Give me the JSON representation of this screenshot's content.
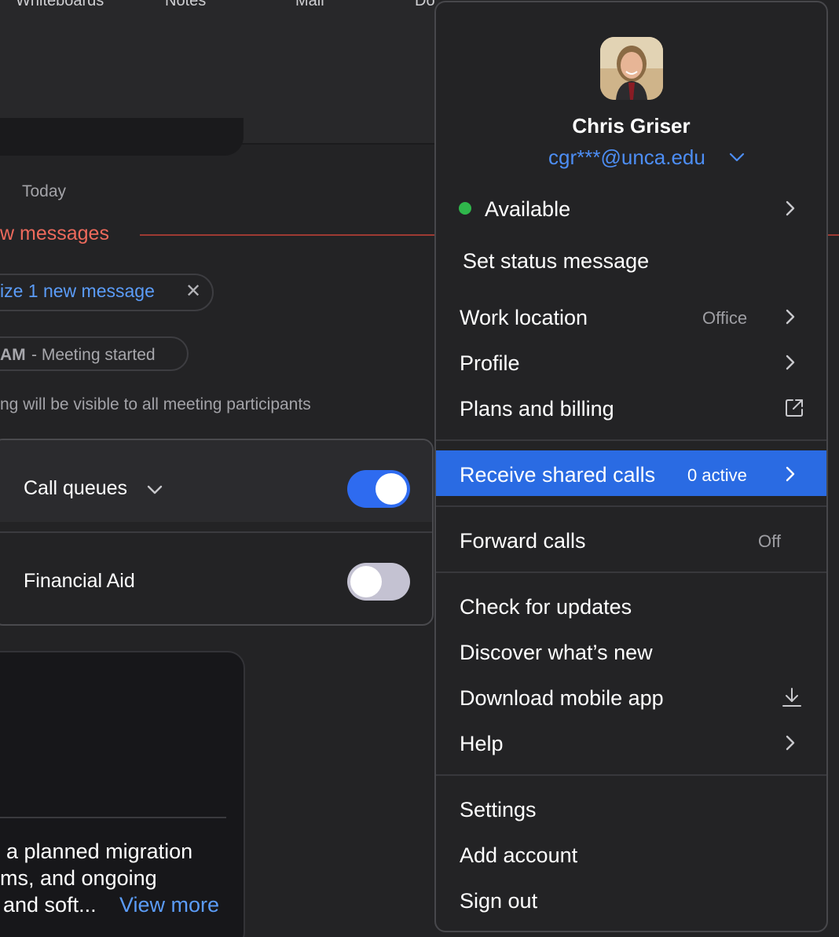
{
  "top_tabs": [
    "Whiteboards",
    "Notes",
    "Mail",
    "Do"
  ],
  "chat": {
    "date_label": "Today",
    "new_messages_label": "w messages",
    "summary_chip": "ize 1 new message",
    "meeting_time": "AM",
    "meeting_status": "- Meeting started",
    "visibility_note": "ng will be visible to all meeting participants"
  },
  "call_queues": {
    "header_label": "Call queues",
    "header_toggle_on": true,
    "items": [
      {
        "label": "Financial Aid",
        "enabled": false
      }
    ]
  },
  "card": {
    "lines": [
      "a planned migration",
      "ms, and ongoing",
      "and soft..."
    ],
    "view_more": "View more"
  },
  "menu": {
    "user_name": "Chris Griser",
    "user_email": "cgr***@unca.edu",
    "status": {
      "label": "Available",
      "color": "#2fb64b"
    },
    "set_status": "Set status message",
    "work_location": {
      "label": "Work location",
      "value": "Office"
    },
    "profile": "Profile",
    "plans_billing": "Plans and billing",
    "receive_shared_calls": {
      "label": "Receive shared calls",
      "badge": "0 active"
    },
    "forward_calls": {
      "label": "Forward calls",
      "value": "Off"
    },
    "check_updates": "Check for updates",
    "discover_new": "Discover what’s new",
    "download_mobile": "Download mobile app",
    "help": "Help",
    "settings": "Settings",
    "add_account": "Add account",
    "sign_out": "Sign out"
  },
  "colors": {
    "accent": "#2a6be3",
    "link": "#4d8ef5",
    "new_messages": "#ee6a5c",
    "background": "#232325"
  },
  "icons": [
    "chevron-right-icon",
    "chevron-down-icon",
    "external-link-icon",
    "download-icon",
    "close-icon"
  ]
}
